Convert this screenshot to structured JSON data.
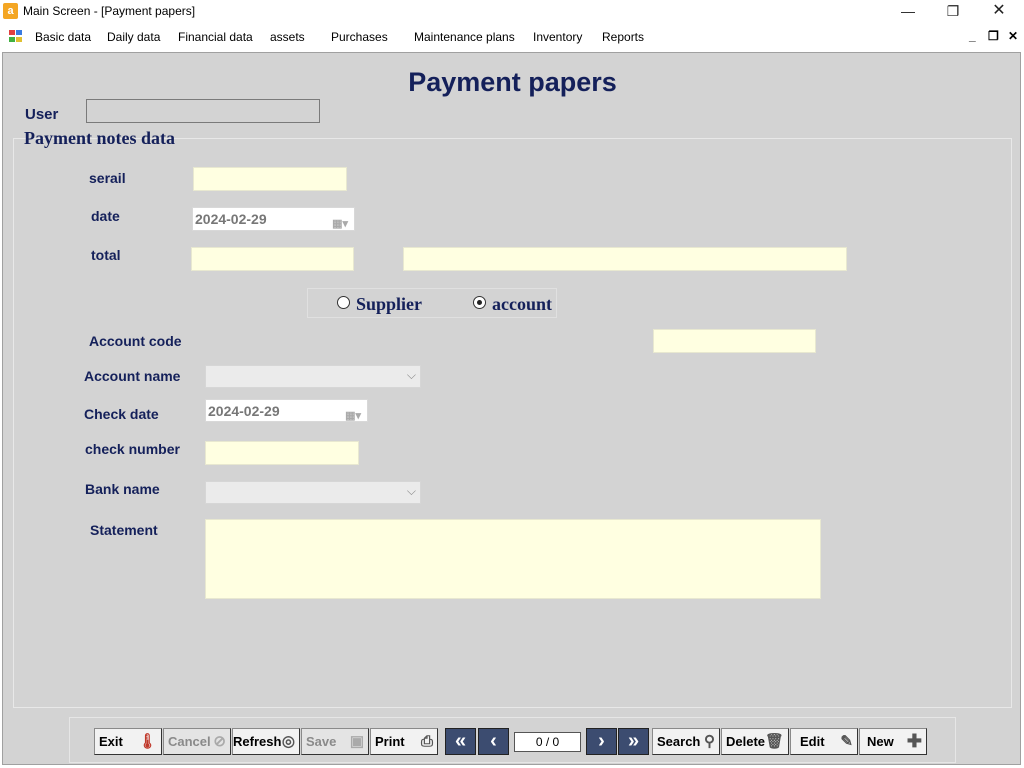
{
  "window": {
    "title": "Main Screen - [Payment papers]",
    "app_icon": "document-icon",
    "minimize": "—",
    "maximize": "❐",
    "close": "✕"
  },
  "menu": {
    "items": [
      "Basic data",
      "Daily data",
      "Financial data",
      "assets",
      "Purchases",
      "Maintenance plans",
      "Inventory",
      "Reports"
    ],
    "mdi_minimize": "_",
    "mdi_restore": "❐",
    "mdi_close": "✕"
  },
  "page": {
    "title": "Payment papers",
    "user_label": "User",
    "user_value": ""
  },
  "form": {
    "group_label": "Payment notes data",
    "serial_label": "serail",
    "serial_value": "",
    "date_label": "date",
    "date_value": "2024-02-29",
    "total_label": "total",
    "total_value": "",
    "total_words": "",
    "radio_supplier": "Supplier",
    "radio_account": "account",
    "selected_option": "account",
    "account_code_label": "Account code",
    "account_code_value": "",
    "account_name_label": "Account name",
    "account_name_value": "",
    "check_date_label": "Check date",
    "check_date_value": "2024-02-29",
    "check_number_label": "check number",
    "check_number_value": "",
    "bank_name_label": "Bank name",
    "bank_name_value": "",
    "statement_label": "Statement",
    "statement_value": ""
  },
  "toolbar": {
    "exit": "Exit",
    "cancel": "Cancel",
    "refresh": "Refresh",
    "save": "Save",
    "print": "Print",
    "first": "«",
    "prev": "‹",
    "pager": "0 / 0",
    "next": "›",
    "last": "»",
    "search": "Search",
    "delete": "Delete",
    "edit": "Edit",
    "new": "New"
  },
  "colors": {
    "label": "#14205a",
    "input_bg": "#ffffe1",
    "client_bg": "#d3d3d3",
    "nav_btn": "#3c4c70"
  }
}
